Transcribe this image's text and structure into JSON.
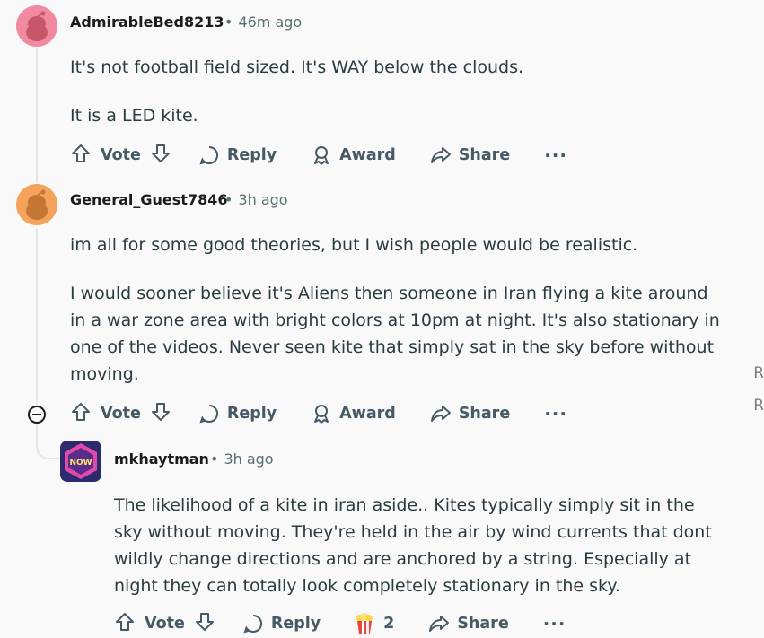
{
  "comments": [
    {
      "username": "AdmirableBed8213",
      "time": "46m ago",
      "paragraphs": [
        "It's not football field sized. It's WAY below the clouds.",
        "It is a LED kite."
      ],
      "actions": {
        "vote": "Vote",
        "reply": "Reply",
        "award": "Award",
        "share": "Share",
        "more": "···"
      }
    },
    {
      "username": "General_Guest7846",
      "time": "3h ago",
      "paragraphs": [
        "im all for some good theories, but I wish people would be realistic.",
        "I would sooner believe it's Aliens then someone in Iran flying a kite around in a war zone area with bright colors at 10pm at night. It's also stationary in one of the videos. Never seen kite that simply sat in the sky before without moving."
      ],
      "actions": {
        "vote": "Vote",
        "reply": "Reply",
        "award": "Award",
        "share": "Share",
        "more": "···"
      }
    },
    {
      "username": "mkhaytman",
      "time": "3h ago",
      "paragraphs": [
        "The likelihood of a kite in iran aside.. Kites typically simply sit in the sky without moving. They're held in the air by wind currents that dont wildly change directions and are anchored by a string. Especially at night they can totally look completely stationary in the sky."
      ],
      "actions": {
        "vote": "Vote",
        "reply": "Reply",
        "award_count": "2",
        "share": "Share",
        "more": "···"
      }
    }
  ],
  "right_edge": [
    "R",
    "R"
  ],
  "colors": {
    "avatar1_bg": "#f08aa0",
    "avatar2_bg": "#f5a35a",
    "action_text": "#455a64",
    "meta_text": "#576f76"
  }
}
